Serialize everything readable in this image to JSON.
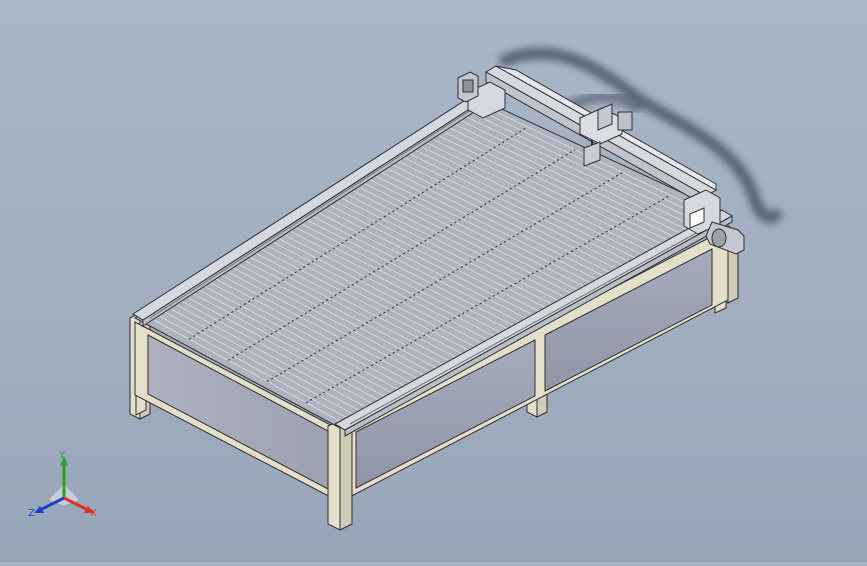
{
  "viewport": {
    "background_top": "#a9b6c8",
    "background_bottom": "#97a5b8"
  },
  "model": {
    "frame_color": "#e3dfc9",
    "panel_color": "#9ea3b4",
    "rail_color": "#c9ccd3",
    "slat_color": "#b5bac4",
    "edge_color": "#2f2f33",
    "cable_shadow_color": "#4a5566"
  },
  "triad": {
    "x_label": "X",
    "y_label": "Y",
    "z_label": "Z",
    "x_color": "#e03020",
    "y_color": "#2ca02c",
    "z_color": "#2040d0"
  }
}
